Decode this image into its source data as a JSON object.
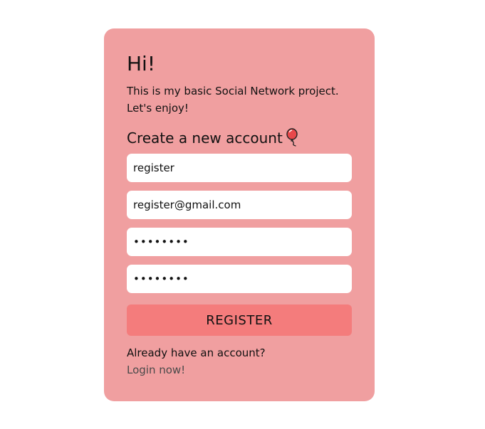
{
  "card": {
    "greeting": "Hi!",
    "intro": "This is my basic Social Network project. Let's enjoy!",
    "form_title": "Create a new account",
    "title_icon": "balloon-icon",
    "fields": {
      "username": "register",
      "email": "register@gmail.com",
      "password": "••••••••",
      "confirm_password": "••••••••"
    },
    "register_label": "REGISTER",
    "already_text": "Already have an account?",
    "login_label": "Login now!"
  },
  "colors": {
    "page_background": "#ffffff",
    "card_background": "#f09fa0",
    "button_background": "#f47c7c",
    "link_color": "#4a4a4a",
    "balloon": "#e8484b"
  }
}
